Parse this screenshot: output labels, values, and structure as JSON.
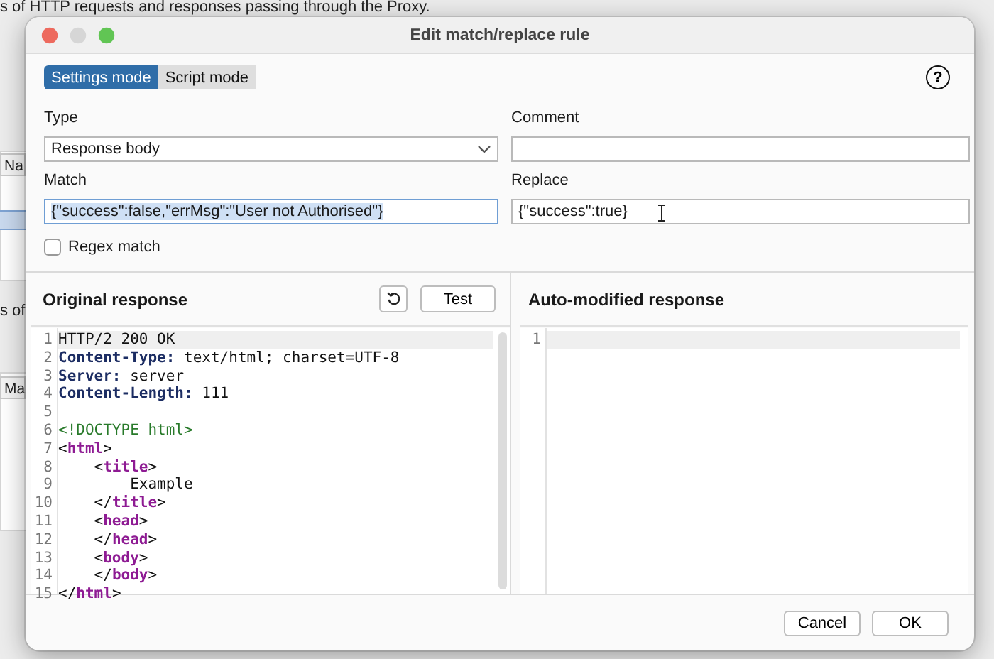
{
  "background": {
    "heading_text": "s of HTTP requests and responses passing through the Proxy.",
    "table_header": "Na",
    "second_heading_text": "s of",
    "second_table_header": "Ma"
  },
  "dialog": {
    "title": "Edit match/replace rule",
    "mode_tabs": [
      {
        "label": "Settings mode",
        "selected": true
      },
      {
        "label": "Script mode",
        "selected": false
      }
    ],
    "help_label": "?",
    "type": {
      "label": "Type",
      "value": "Response body"
    },
    "comment": {
      "label": "Comment"
    },
    "match": {
      "label": "Match",
      "value": "{\"success\":false,\"errMsg\":\"User not Authorised\"}",
      "text_selected": true
    },
    "replace": {
      "label": "Replace",
      "value": "{\"success\":true}"
    },
    "regex_match": {
      "label": "Regex match",
      "checked": false
    },
    "original_response": {
      "title": "Original response",
      "test_button": "Test",
      "lines": [
        {
          "number": "1",
          "highlighted": true,
          "segments": [
            {
              "kind": "plain",
              "text": "HTTP/2 200 OK"
            }
          ]
        },
        {
          "number": "2",
          "highlighted": false,
          "segments": [
            {
              "kind": "header",
              "text": "Content-Type:"
            },
            {
              "kind": "plain",
              "text": " text/html; charset=UTF-8"
            }
          ]
        },
        {
          "number": "3",
          "highlighted": false,
          "segments": [
            {
              "kind": "header",
              "text": "Server:"
            },
            {
              "kind": "plain",
              "text": " server"
            }
          ]
        },
        {
          "number": "4",
          "highlighted": false,
          "segments": [
            {
              "kind": "header",
              "text": "Content-Length:"
            },
            {
              "kind": "plain",
              "text": " 111"
            }
          ]
        },
        {
          "number": "5",
          "highlighted": false
        },
        {
          "number": "6",
          "highlighted": false,
          "segments": [
            {
              "kind": "doctype",
              "text": "<!DOCTYPE html>"
            }
          ]
        },
        {
          "number": "7",
          "highlighted": false,
          "segments": [
            {
              "kind": "plain",
              "text": "<"
            },
            {
              "kind": "tag",
              "text": "html"
            },
            {
              "kind": "plain",
              "text": ">"
            }
          ]
        },
        {
          "number": "8",
          "highlighted": false,
          "segments": [
            {
              "kind": "plain",
              "text": "    <"
            },
            {
              "kind": "tag",
              "text": "title"
            },
            {
              "kind": "plain",
              "text": ">"
            }
          ]
        },
        {
          "number": "9",
          "highlighted": false,
          "segments": [
            {
              "kind": "plain",
              "text": "        Example"
            }
          ]
        },
        {
          "number": "10",
          "highlighted": false,
          "segments": [
            {
              "kind": "plain",
              "text": "    </"
            },
            {
              "kind": "tag",
              "text": "title"
            },
            {
              "kind": "plain",
              "text": ">"
            }
          ]
        },
        {
          "number": "11",
          "highlighted": false,
          "segments": [
            {
              "kind": "plain",
              "text": "    <"
            },
            {
              "kind": "tag",
              "text": "head"
            },
            {
              "kind": "plain",
              "text": ">"
            }
          ]
        },
        {
          "number": "12",
          "highlighted": false,
          "segments": [
            {
              "kind": "plain",
              "text": "    </"
            },
            {
              "kind": "tag",
              "text": "head"
            },
            {
              "kind": "plain",
              "text": ">"
            }
          ]
        },
        {
          "number": "13",
          "highlighted": false,
          "segments": [
            {
              "kind": "plain",
              "text": "    <"
            },
            {
              "kind": "tag",
              "text": "body"
            },
            {
              "kind": "plain",
              "text": ">"
            }
          ]
        },
        {
          "number": "14",
          "highlighted": false,
          "segments": [
            {
              "kind": "plain",
              "text": "    </"
            },
            {
              "kind": "tag",
              "text": "body"
            },
            {
              "kind": "plain",
              "text": ">"
            }
          ]
        },
        {
          "number": "15",
          "highlighted": false,
          "segments": [
            {
              "kind": "plain",
              "text": "</"
            },
            {
              "kind": "tag",
              "text": "html"
            },
            {
              "kind": "plain",
              "text": ">"
            }
          ]
        }
      ]
    },
    "modified_response": {
      "title": "Auto-modified response",
      "lines": [
        {
          "number": "1",
          "highlighted": true
        }
      ]
    },
    "buttons": [
      "Cancel",
      "OK"
    ]
  }
}
